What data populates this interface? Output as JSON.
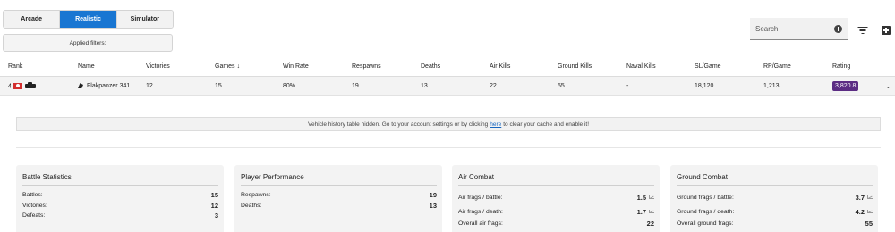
{
  "modes": {
    "tabs": [
      "Arcade",
      "Realistic",
      "Simulator"
    ],
    "active": "Realistic"
  },
  "filters": {
    "label": "Applied filters:"
  },
  "search": {
    "placeholder": "Search"
  },
  "table": {
    "headers": {
      "rank": "Rank",
      "name": "Name",
      "victories": "Victories",
      "games": "Games",
      "win_rate": "Win Rate",
      "respawns": "Respawns",
      "deaths": "Deaths",
      "air_kills": "Air Kills",
      "ground_kills": "Ground Kills",
      "naval_kills": "Naval Kills",
      "sl_game": "SL/Game",
      "rp_game": "RP/Game",
      "rating": "Rating"
    },
    "sort_indicator": "↓",
    "row": {
      "rank": "4",
      "name": "Flakpanzer 341",
      "victories": "12",
      "games": "15",
      "win_rate": "80%",
      "respawns": "19",
      "deaths": "13",
      "air_kills": "22",
      "ground_kills": "55",
      "naval_kills": "-",
      "sl_game": "18,120",
      "rp_game": "1,213",
      "rating": "3,820.8",
      "rating_color": "#5b2c83",
      "nation_flag_color": "#d32f2f"
    }
  },
  "notice": {
    "before": "Vehicle history table hidden. Go to your account settings or by clicking",
    "link": "here",
    "after": "to clear your cache and enable it!"
  },
  "cards": {
    "battle": {
      "title": "Battle Statistics",
      "rows": [
        {
          "label": "Battles:",
          "value": "15"
        },
        {
          "label": "Victories:",
          "value": "12"
        },
        {
          "label": "Defeats:",
          "value": "3"
        }
      ]
    },
    "performance": {
      "title": "Player Performance",
      "rows": [
        {
          "label": "Respawns:",
          "value": "19"
        },
        {
          "label": "Deaths:",
          "value": "13"
        }
      ]
    },
    "air": {
      "title": "Air Combat",
      "rows": [
        {
          "label": "Air frags / battle:",
          "value": "1.5"
        },
        {
          "label": "Air frags / death:",
          "value": "1.7"
        },
        {
          "label": "Overall air frags:",
          "value": "22"
        }
      ]
    },
    "ground": {
      "title": "Ground Combat",
      "rows": [
        {
          "label": "Ground frags / battle:",
          "value": "3.7"
        },
        {
          "label": "Ground frags / death:",
          "value": "4.2"
        },
        {
          "label": "Overall ground frags:",
          "value": "55"
        }
      ]
    }
  },
  "colors": {
    "accent": "#1976d2",
    "link": "#1565c0"
  }
}
